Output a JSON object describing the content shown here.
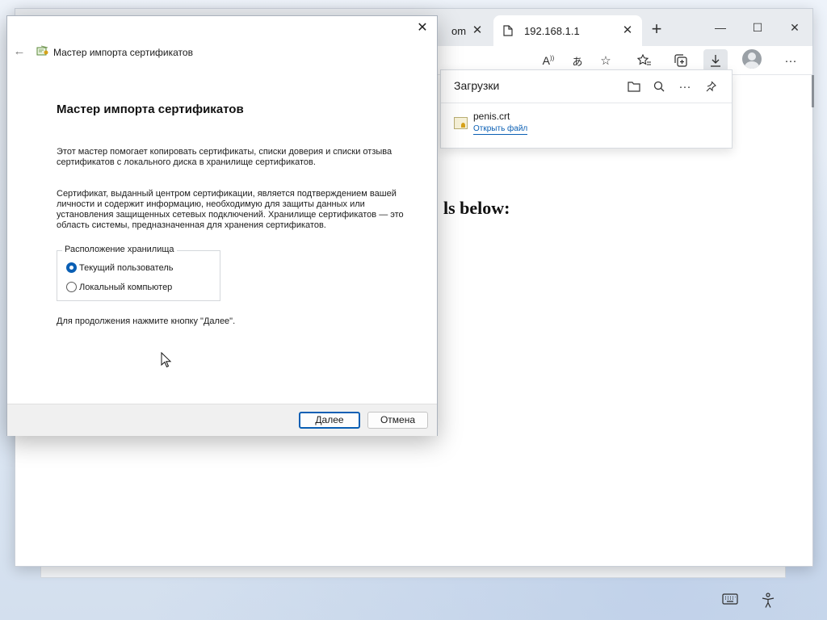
{
  "browser": {
    "tabs": [
      {
        "label": "om",
        "active": false
      },
      {
        "label": "192.168.1.1",
        "active": true
      }
    ],
    "new_tab_symbol": "+",
    "page_heading_fragment": "ls below:",
    "toolbar_icons": [
      "read-aloud-icon",
      "translate-icon",
      "add-favorite-icon",
      "favorites-icon",
      "collections-icon",
      "downloads-icon",
      "profile-avatar",
      "more-icon"
    ]
  },
  "downloads": {
    "title": "Загрузки",
    "file_name": "penis.crt",
    "open_file_link": "Открыть файл"
  },
  "wizard": {
    "window_title": "Мастер импорта сертификатов",
    "heading": "Мастер импорта сертификатов",
    "para1": "Этот мастер помогает копировать сертификаты, списки доверия и списки отзыва сертификатов с локального диска в хранилище сертификатов.",
    "para2": "Сертификат, выданный центром сертификации, является подтверждением вашей личности и содержит информацию, необходимую для защиты данных или установления защищенных сетевых подключений. Хранилище сертификатов — это область системы, предназначенная для хранения сертификатов.",
    "store_group_label": "Расположение хранилища",
    "options": [
      {
        "label": "Текущий пользователь",
        "checked": true
      },
      {
        "label": "Локальный компьютер",
        "checked": false
      }
    ],
    "continue_text": "Для продолжения нажмите кнопку \"Далее\".",
    "next_button": "Далее",
    "cancel_button": "Отмена"
  },
  "colors": {
    "accent": "#0a5fb4",
    "dialog_footer": "#f0f0f0",
    "tabstrip": "#e8ebef"
  }
}
